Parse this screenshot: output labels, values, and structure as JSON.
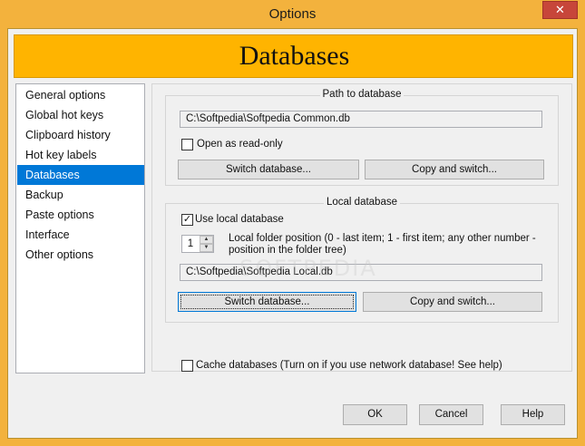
{
  "window": {
    "title": "Options",
    "close_glyph": "✕"
  },
  "banner": {
    "title": "Databases"
  },
  "nav": {
    "items": [
      {
        "label": "General options"
      },
      {
        "label": "Global hot keys"
      },
      {
        "label": "Clipboard history"
      },
      {
        "label": "Hot key labels"
      },
      {
        "label": "Databases",
        "selected": true
      },
      {
        "label": "Backup"
      },
      {
        "label": "Paste options"
      },
      {
        "label": "Interface"
      },
      {
        "label": "Other options"
      }
    ]
  },
  "path_group": {
    "title": "Path to database",
    "path_value": "C:\\Softpedia\\Softpedia Common.db",
    "readonly_label": "Open as read-only",
    "readonly_checked": false,
    "switch_label": "Switch database...",
    "copy_label": "Copy and switch..."
  },
  "local_group": {
    "title": "Local database",
    "use_local_label": "Use local database",
    "use_local_checked": true,
    "position_value": "1",
    "position_label_line1": "Local folder position (0 - last item; 1 - first item; any other number -",
    "position_label_line2": "position in the folder tree)",
    "path_value": "C:\\Softpedia\\Softpedia Local.db",
    "switch_label": "Switch database...",
    "copy_label": "Copy and switch..."
  },
  "cache": {
    "label": "Cache databases (Turn on if you use network database! See help)",
    "checked": false
  },
  "footer": {
    "ok_label": "OK",
    "cancel_label": "Cancel",
    "help_label": "Help"
  },
  "watermark": "SOFTPEDIA",
  "colors": {
    "accent": "#ffb400",
    "selection": "#0078d7",
    "frame": "#f3b23d",
    "close": "#c7463a"
  }
}
